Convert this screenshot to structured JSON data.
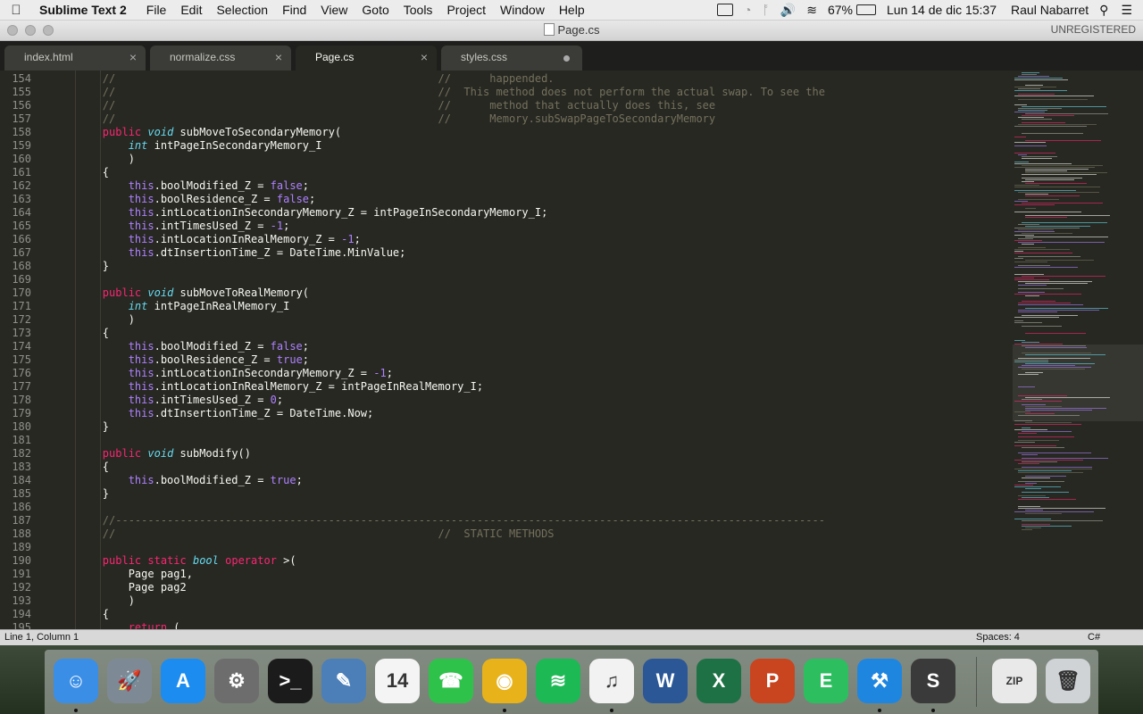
{
  "menubar": {
    "app_name": "Sublime Text 2",
    "items": [
      "File",
      "Edit",
      "Selection",
      "Find",
      "View",
      "Goto",
      "Tools",
      "Project",
      "Window",
      "Help"
    ],
    "battery": "67%",
    "datetime": "Lun 14 de dic  15:37",
    "user": "Raul Nabarret"
  },
  "window": {
    "title": "Page.cs",
    "registration": "UNREGISTERED"
  },
  "tabs": [
    {
      "label": "index.html",
      "active": false,
      "dirty": false
    },
    {
      "label": "normalize.css",
      "active": false,
      "dirty": false
    },
    {
      "label": "Page.cs",
      "active": true,
      "dirty": false
    },
    {
      "label": "styles.css",
      "active": false,
      "dirty": true
    }
  ],
  "editor": {
    "lines": [
      {
        "n": "154",
        "code": "        //                                                  //      happended."
      },
      {
        "n": "155",
        "code": "        //                                                  //  This method does not perform the actual swap. To see the"
      },
      {
        "n": "156",
        "code": "        //                                                  //      method that actually does this, see"
      },
      {
        "n": "157",
        "code": "        //                                                  //      Memory.subSwapPageToSecondaryMemory"
      },
      {
        "n": "158",
        "code": "        public void subMoveToSecondaryMemory("
      },
      {
        "n": "159",
        "code": "            int intPageInSecondaryMemory_I"
      },
      {
        "n": "160",
        "code": "            )"
      },
      {
        "n": "161",
        "code": "        {"
      },
      {
        "n": "162",
        "code": "            this.boolModified_Z = false;"
      },
      {
        "n": "163",
        "code": "            this.boolResidence_Z = false;"
      },
      {
        "n": "164",
        "code": "            this.intLocationInSecondaryMemory_Z = intPageInSecondaryMemory_I;"
      },
      {
        "n": "165",
        "code": "            this.intTimesUsed_Z = -1;"
      },
      {
        "n": "166",
        "code": "            this.intLocationInRealMemory_Z = -1;"
      },
      {
        "n": "167",
        "code": "            this.dtInsertionTime_Z = DateTime.MinValue;"
      },
      {
        "n": "168",
        "code": "        }"
      },
      {
        "n": "169",
        "code": ""
      },
      {
        "n": "170",
        "code": "        public void subMoveToRealMemory("
      },
      {
        "n": "171",
        "code": "            int intPageInRealMemory_I"
      },
      {
        "n": "172",
        "code": "            )"
      },
      {
        "n": "173",
        "code": "        {"
      },
      {
        "n": "174",
        "code": "            this.boolModified_Z = false;"
      },
      {
        "n": "175",
        "code": "            this.boolResidence_Z = true;"
      },
      {
        "n": "176",
        "code": "            this.intLocationInSecondaryMemory_Z = -1;"
      },
      {
        "n": "177",
        "code": "            this.intLocationInRealMemory_Z = intPageInRealMemory_I;"
      },
      {
        "n": "178",
        "code": "            this.intTimesUsed_Z = 0;"
      },
      {
        "n": "179",
        "code": "            this.dtInsertionTime_Z = DateTime.Now;"
      },
      {
        "n": "180",
        "code": "        }"
      },
      {
        "n": "181",
        "code": ""
      },
      {
        "n": "182",
        "code": "        public void subModify()"
      },
      {
        "n": "183",
        "code": "        {"
      },
      {
        "n": "184",
        "code": "            this.boolModified_Z = true;"
      },
      {
        "n": "185",
        "code": "        }"
      },
      {
        "n": "186",
        "code": ""
      },
      {
        "n": "187",
        "code": "        //--------------------------------------------------------------------------------------------------------------"
      },
      {
        "n": "188",
        "code": "        //                                                  //  STATIC METHODS"
      },
      {
        "n": "189",
        "code": ""
      },
      {
        "n": "190",
        "code": "        public static bool operator >("
      },
      {
        "n": "191",
        "code": "            Page pag1,"
      },
      {
        "n": "192",
        "code": "            Page pag2"
      },
      {
        "n": "193",
        "code": "            )"
      },
      {
        "n": "194",
        "code": "        {"
      },
      {
        "n": "195",
        "code": "            return ("
      }
    ]
  },
  "statusbar": {
    "position": "Line 1, Column 1",
    "spaces": "Spaces: 4",
    "syntax": "C#"
  },
  "dock": {
    "items": [
      {
        "name": "finder-icon",
        "glyph": "☺",
        "color": "#3a8ee6",
        "running": true
      },
      {
        "name": "launchpad-icon",
        "glyph": "🚀",
        "color": "#7d8a96",
        "running": false
      },
      {
        "name": "app-store-icon",
        "glyph": "A",
        "color": "#1c8cf0",
        "running": false
      },
      {
        "name": "system-preferences-icon",
        "glyph": "⚙",
        "color": "#6d6d6d",
        "running": false
      },
      {
        "name": "terminal-icon",
        "glyph": ">_",
        "color": "#1b1b1b",
        "running": false
      },
      {
        "name": "preview-icon",
        "glyph": "✎",
        "color": "#4c7fb8",
        "running": false
      },
      {
        "name": "calendar-icon",
        "glyph": "14",
        "color": "#f4f4f4",
        "running": false
      },
      {
        "name": "facetime-icon",
        "glyph": "☎",
        "color": "#2fc24b",
        "running": false
      },
      {
        "name": "chrome-icon",
        "glyph": "◉",
        "color": "#e8b21b",
        "running": true
      },
      {
        "name": "spotify-icon",
        "glyph": "≋",
        "color": "#1db954",
        "running": false
      },
      {
        "name": "itunes-icon",
        "glyph": "♫",
        "color": "#f2f2f2",
        "running": true
      },
      {
        "name": "word-icon",
        "glyph": "W",
        "color": "#2b5797",
        "running": false
      },
      {
        "name": "excel-icon",
        "glyph": "X",
        "color": "#1e7145",
        "running": false
      },
      {
        "name": "powerpoint-icon",
        "glyph": "P",
        "color": "#c8451f",
        "running": false
      },
      {
        "name": "evernote-icon",
        "glyph": "E",
        "color": "#2dbe60",
        "running": false
      },
      {
        "name": "xcode-icon",
        "glyph": "⚒",
        "color": "#1f86e0",
        "running": true
      },
      {
        "name": "sublime-text-icon",
        "glyph": "S",
        "color": "#3a3a3a",
        "running": true
      },
      {
        "name": "archive-icon",
        "glyph": "ZIP",
        "color": "#e9e9e9",
        "running": false
      },
      {
        "name": "trash-icon",
        "glyph": "🗑",
        "color": "#cfd3d6",
        "running": false
      }
    ]
  }
}
